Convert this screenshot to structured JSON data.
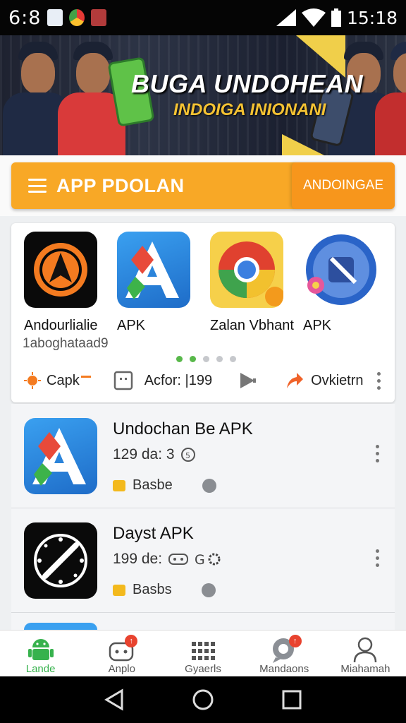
{
  "status_bar": {
    "time_left": "6:8",
    "time_right": "15:18"
  },
  "banner": {
    "title": "BUGA UNDOHEAN",
    "subtitle": "INDOIGA INIONANI"
  },
  "app_bar": {
    "title": "APP PDOLAN",
    "action_label": "ANDOINGAE"
  },
  "featured": {
    "apps": [
      {
        "label": "Andourlialie",
        "icon": "compass-arrow-icon"
      },
      {
        "label": "APK",
        "icon": "letter-a-icon"
      },
      {
        "label": "Zalan Vbhant",
        "icon": "chrome-like-icon"
      },
      {
        "label": "APK",
        "icon": "blue-badge-icon"
      }
    ],
    "subtitle": "1aboghataad9",
    "page_dots": {
      "count": 5,
      "active": [
        0,
        1
      ]
    },
    "actions": [
      {
        "label": "Capk",
        "icon": "sun-icon"
      },
      {
        "label": "Acfor: |199",
        "icon": "frame-icon"
      },
      {
        "label": "",
        "icon": "play-icon"
      },
      {
        "label": "Ovkietrn",
        "icon": "share-arrow-icon"
      }
    ]
  },
  "list": [
    {
      "name": "Undochan Be APK",
      "meta": "129 da: 3",
      "tag": "Basbe",
      "icon": "letter-a-icon"
    },
    {
      "name": "Dayst APK",
      "meta": "199 de:",
      "tag": "Basbs",
      "icon": "clock-ring-icon"
    }
  ],
  "bottom_nav": [
    {
      "label": "Lande",
      "icon": "android-icon",
      "active": true
    },
    {
      "label": "Anplo",
      "icon": "chat-robot-icon",
      "badge": true
    },
    {
      "label": "Gyaerls",
      "icon": "grid-icon"
    },
    {
      "label": "Mandaons",
      "icon": "bubble-icon",
      "badge": true
    },
    {
      "label": "Miahamah",
      "icon": "person-icon"
    }
  ],
  "colors": {
    "accent": "#f8a826",
    "active_green": "#37b24d"
  }
}
